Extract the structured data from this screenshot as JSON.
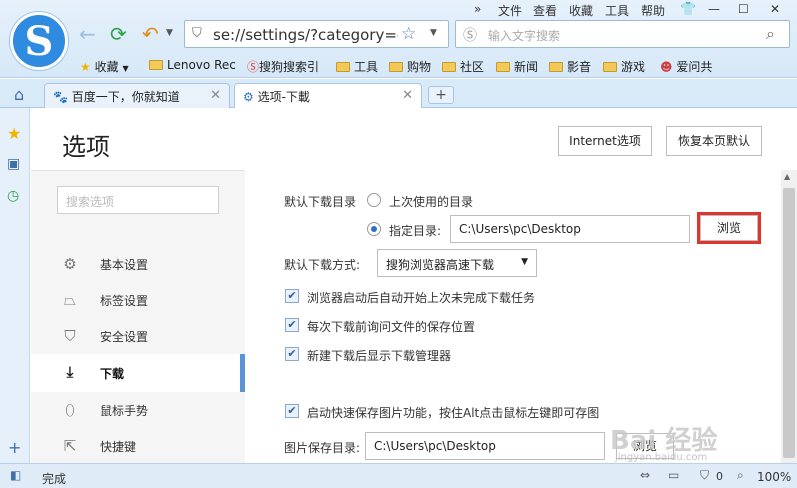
{
  "menu": [
    "文件",
    "查看",
    "收藏",
    "工具",
    "帮助"
  ],
  "address": {
    "text": "se://settings/?category=dow"
  },
  "search": {
    "placeholder": "输入文字搜索"
  },
  "bookmarks": {
    "favorites": "收藏",
    "items": [
      "Lenovo Rec",
      "搜狗搜索引",
      "工具",
      "购物",
      "社区",
      "新闻",
      "影音",
      "游戏",
      "爱问共"
    ]
  },
  "tabs": [
    {
      "label": "百度一下，你就知道"
    },
    {
      "label": "选项-下載"
    }
  ],
  "page": {
    "title": "选项",
    "internet_options": "Internet选项",
    "restore_defaults": "恢复本页默认"
  },
  "nav": {
    "search_placeholder": "搜索选项",
    "items": [
      "基本设置",
      "标签设置",
      "安全设置",
      "下载",
      "鼠标手势",
      "快捷键"
    ]
  },
  "download": {
    "default_dir_label": "默认下载目录",
    "last_used_label": "上次使用的目录",
    "specified_label": "指定目录:",
    "dir_value": "C:\\Users\\pc\\Desktop",
    "browse": "浏览",
    "method_label": "默认下载方式:",
    "method_value": "搜狗浏览器高速下载",
    "opt_resume": "浏览器启动后自动开始上次未完成下载任务",
    "opt_ask_location": "每次下载前询问文件的保存位置",
    "opt_show_manager": "新建下载后显示下载管理器",
    "opt_quick_save": "启动快速保存图片功能，按住Alt点击鼠标左键即可存图",
    "image_dir_label": "图片保存目录:",
    "image_dir_value": "C:\\Users\\pc\\Desktop",
    "browse2": "浏览"
  },
  "status": {
    "text": "完成",
    "zoom": "100%"
  },
  "watermark": {
    "main": "Bai 经验",
    "sub": "jingyan.baidu.com"
  }
}
